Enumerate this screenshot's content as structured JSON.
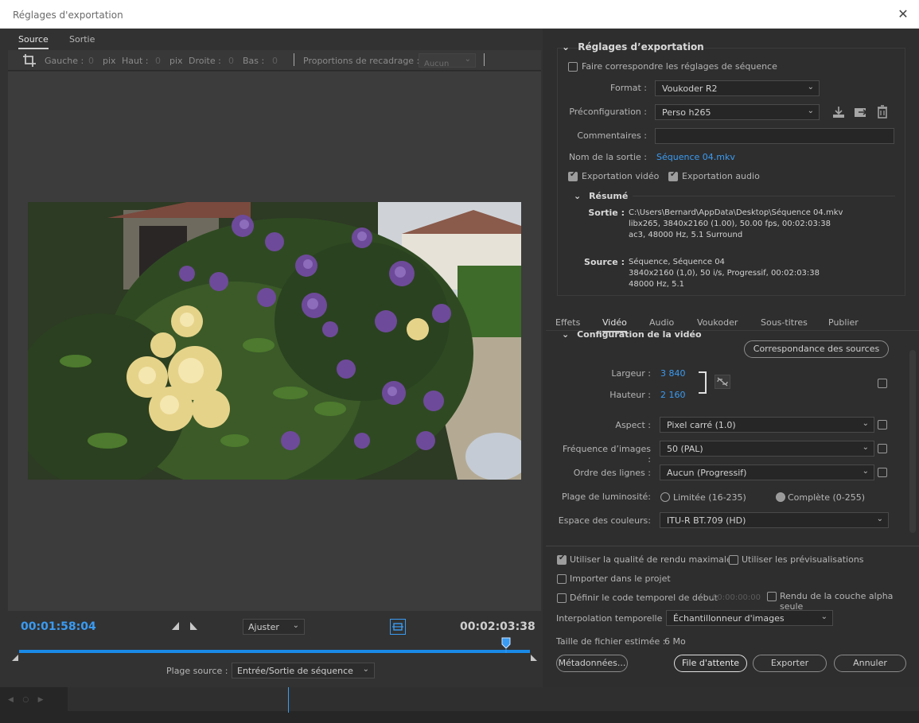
{
  "window": {
    "title": "Réglages d'exportation"
  },
  "left_tabs": [
    "Source",
    "Sortie"
  ],
  "crop": {
    "left_label": "Gauche :",
    "left_val": "0",
    "left_unit": "pix",
    "top_label": "Haut :",
    "top_val": "0",
    "top_unit": "pix",
    "right_label": "Droite :",
    "right_val": "0",
    "bottom_label": "Bas :",
    "bottom_val": "0",
    "ratio_label": "Proportions de recadrage :",
    "ratio_value": "Aucun"
  },
  "timeline": {
    "current": "00:01:58:04",
    "duration": "00:02:03:38",
    "fit_value": "Ajuster",
    "source_range_label": "Plage source :",
    "source_range_value": "Entrée/Sortie de séquence"
  },
  "export_settings": {
    "header": "Réglages d’exportation",
    "match_sequence": "Faire correspondre les réglages de séquence",
    "format_label": "Format :",
    "format_value": "Voukoder R2",
    "preset_label": "Préconfiguration :",
    "preset_value": "Perso h265",
    "comments_label": "Commentaires :",
    "output_label": "Nom de la sortie :",
    "output_value": "Séquence 04.mkv",
    "export_video": "Exportation vidéo",
    "export_audio": "Exportation audio",
    "summary_header": "Résumé",
    "sortie_label": "Sortie :",
    "sortie_lines": [
      "C:\\Users\\Bernard\\AppData\\Desktop\\Séquence 04.mkv",
      "libx265, 3840x2160 (1.00), 50.00 fps, 00:02:03:38",
      "ac3, 48000 Hz, 5.1 Surround"
    ],
    "source_label": "Source :",
    "source_lines": [
      "Séquence, Séquence 04",
      "3840x2160 (1,0), 50  i/s, Progressif, 00:02:03:38",
      "48000 Hz, 5.1"
    ]
  },
  "right_tabs": [
    "Effets",
    "Vidéo",
    "Audio",
    "Voukoder",
    "Sous-titres",
    "Publier"
  ],
  "video": {
    "section_title": "Configuration de la vidéo",
    "match_sources_btn": "Correspondance des sources",
    "width_label": "Largeur :",
    "width_value": "3 840",
    "height_label": "Hauteur :",
    "height_value": "2 160",
    "aspect_label": "Aspect :",
    "aspect_value": "Pixel carré (1.0)",
    "fps_label": "Fréquence d’images :",
    "fps_value": "50 (PAL)",
    "field_order_label": "Ordre des lignes :",
    "field_order_value": "Aucun (Progressif)",
    "luma_label": "Plage de luminosité:",
    "luma_limited": "Limitée (16-235)",
    "luma_full": "Complète (0-255)",
    "colorspace_label": "Espace des couleurs:",
    "colorspace_value": "ITU-R BT.709 (HD)"
  },
  "options": {
    "max_quality": "Utiliser la qualité de rendu maximale",
    "use_previews": "Utiliser les prévisualisations",
    "import_project": "Importer dans le projet",
    "start_timecode": "Définir le code temporel de début",
    "start_timecode_value": "00:00:00:00",
    "alpha_only": "Rendu de la couche alpha seule",
    "interp_label": "Interpolation temporelle :",
    "interp_value": "Échantillonneur d'images",
    "filesize_label": "Taille de fichier estimée :",
    "filesize_value": "6 Mo"
  },
  "buttons": {
    "metadata": "Métadonnées...",
    "queue": "File d'attente",
    "export": "Exporter",
    "cancel": "Annuler"
  }
}
